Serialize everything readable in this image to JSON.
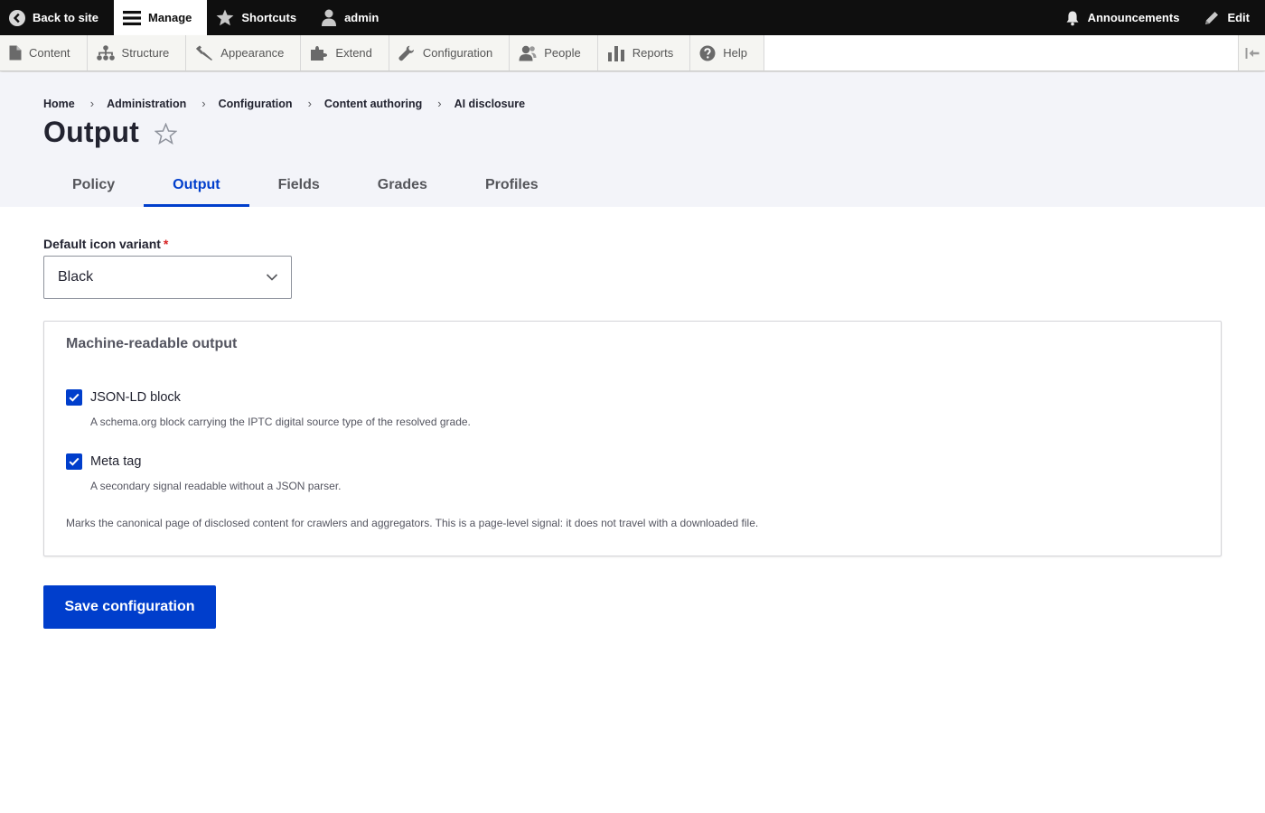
{
  "toolbar": {
    "back_to_site": "Back to site",
    "manage": "Manage",
    "shortcuts": "Shortcuts",
    "user": "admin",
    "announcements": "Announcements",
    "edit": "Edit"
  },
  "tray": {
    "items": [
      {
        "label": "Content",
        "icon": "file-icon"
      },
      {
        "label": "Structure",
        "icon": "sitemap-icon"
      },
      {
        "label": "Appearance",
        "icon": "paintbrush-icon"
      },
      {
        "label": "Extend",
        "icon": "puzzle-icon"
      },
      {
        "label": "Configuration",
        "icon": "wrench-icon"
      },
      {
        "label": "People",
        "icon": "people-icon"
      },
      {
        "label": "Reports",
        "icon": "bar-chart-icon"
      },
      {
        "label": "Help",
        "icon": "help-icon"
      }
    ]
  },
  "breadcrumb": [
    "Home",
    "Administration",
    "Configuration",
    "Content authoring",
    "AI disclosure"
  ],
  "page": {
    "title": "Output"
  },
  "tabs": [
    {
      "label": "Policy",
      "active": false
    },
    {
      "label": "Output",
      "active": true
    },
    {
      "label": "Fields",
      "active": false
    },
    {
      "label": "Grades",
      "active": false
    },
    {
      "label": "Profiles",
      "active": false
    }
  ],
  "form": {
    "icon_variant": {
      "label": "Default icon variant",
      "required_mark": "*",
      "value": "Black"
    },
    "machine_output": {
      "legend": "Machine-readable output",
      "jsonld": {
        "label": "JSON-LD block",
        "checked": true,
        "description": "A schema.org block carrying the IPTC digital source type of the resolved grade."
      },
      "meta": {
        "label": "Meta tag",
        "checked": true,
        "description": "A secondary signal readable without a JSON parser."
      },
      "description": "Marks the canonical page of disclosed content for crawlers and aggregators. This is a page-level signal: it does not travel with a downloaded file."
    },
    "save_label": "Save configuration"
  },
  "colors": {
    "accent": "#003ecc",
    "toolbar_bg": "#0f0f0f",
    "header_bg": "#f3f4f9",
    "required": "#d72222"
  }
}
